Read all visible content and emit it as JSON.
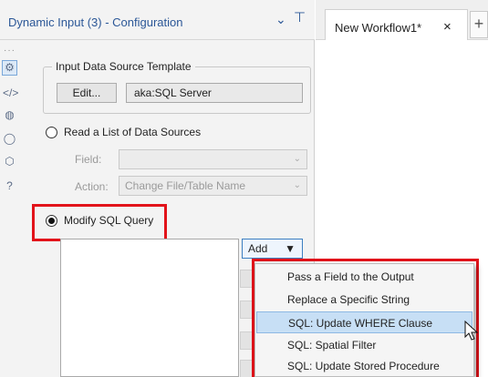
{
  "panel": {
    "title": "Dynamic Input (3) - Configuration",
    "chevron_icon": "chevron-down-icon",
    "pin_icon": "pin-icon",
    "sidebar_icons": [
      "gear-icon",
      "code-icon",
      "annotation-icon",
      "tag-icon",
      "cube-icon",
      "help-icon"
    ]
  },
  "template": {
    "legend": "Input Data Source Template",
    "edit_label": "Edit...",
    "source_value": "aka:SQL Server"
  },
  "read_list": {
    "label": "Read a List of Data Sources",
    "field_label": "Field:",
    "field_value": "",
    "action_label": "Action:",
    "action_value": "Change File/Table Name"
  },
  "modify_sql": {
    "label": "Modify SQL Query",
    "add_label": "Add"
  },
  "add_menu": {
    "items": [
      "Pass a Field to the Output",
      "Replace a Specific String",
      "SQL: Update WHERE Clause",
      "SQL: Spatial Filter",
      "SQL: Update Stored Procedure"
    ],
    "selected": "SQL: Update WHERE Clause"
  },
  "workflow": {
    "tab_label": "New Workflow1*",
    "close_glyph": "×",
    "add_glyph": "+"
  },
  "colors": {
    "accent": "#2b5797",
    "highlight_red": "#e2131a",
    "menu_selected": "#c7dff5"
  }
}
